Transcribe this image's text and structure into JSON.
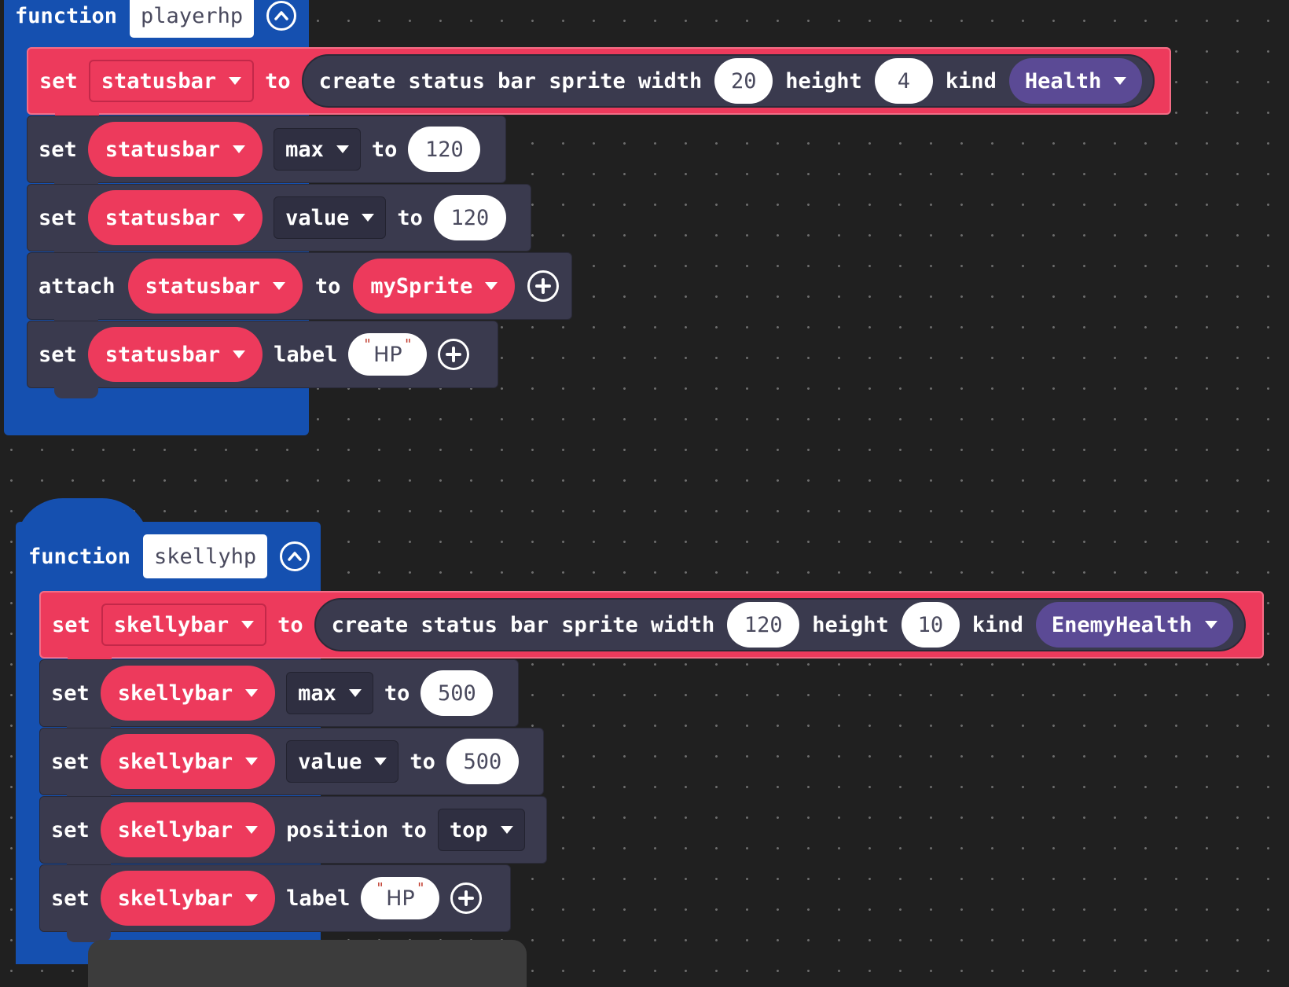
{
  "functions": [
    {
      "keyword": "function",
      "name": "playerhp",
      "create": {
        "set_label": "set",
        "variable": "statusbar",
        "to_label": "to",
        "text": "create status bar sprite width",
        "width": "20",
        "height_label": "height",
        "height": "4",
        "kind_label": "kind",
        "kind": "Health"
      },
      "max_row": {
        "set": "set",
        "variable": "statusbar",
        "prop": "max",
        "to": "to",
        "value": "120"
      },
      "value_row": {
        "set": "set",
        "variable": "statusbar",
        "prop": "value",
        "to": "to",
        "value": "120"
      },
      "attach_row": {
        "attach": "attach",
        "variable": "statusbar",
        "to": "to",
        "sprite": "mySprite"
      },
      "label_row": {
        "set": "set",
        "variable": "statusbar",
        "label": "label",
        "text": "HP"
      }
    },
    {
      "keyword": "function",
      "name": "skellyhp",
      "create": {
        "set_label": "set",
        "variable": "skellybar",
        "to_label": "to",
        "text": "create status bar sprite width",
        "width": "120",
        "height_label": "height",
        "height": "10",
        "kind_label": "kind",
        "kind": "EnemyHealth"
      },
      "max_row": {
        "set": "set",
        "variable": "skellybar",
        "prop": "max",
        "to": "to",
        "value": "500"
      },
      "value_row": {
        "set": "set",
        "variable": "skellybar",
        "prop": "value",
        "to": "to",
        "value": "500"
      },
      "position_row": {
        "set": "set",
        "variable": "skellybar",
        "text": "position to",
        "position": "top"
      },
      "label_row": {
        "set": "set",
        "variable": "skellybar",
        "label": "label",
        "text": "HP"
      }
    }
  ],
  "icons": {
    "collapse": "collapse-chevron-up-icon",
    "add": "add-plus-icon",
    "dropdown": "dropdown-triangle-icon"
  },
  "colors": {
    "workspace": "#202020",
    "function_block": "#1550b0",
    "status_bar_block": "#ed3a5c",
    "statement_block": "#3a3a4e",
    "kind_enum": "#5b4a95"
  }
}
